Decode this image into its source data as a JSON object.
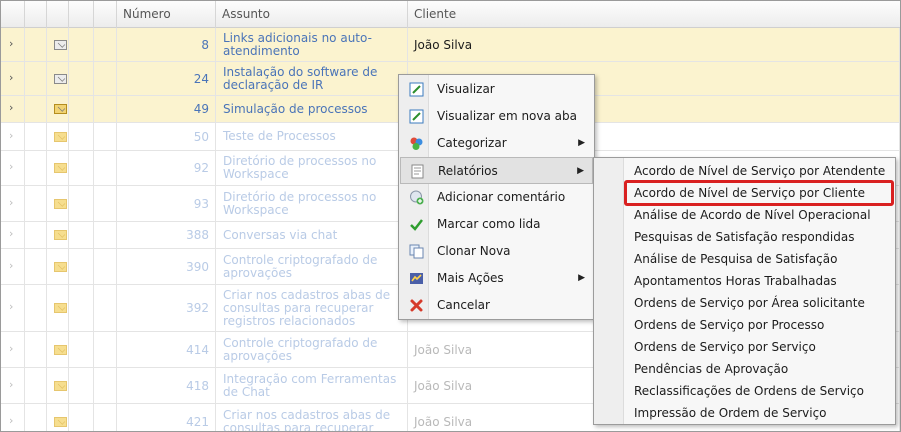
{
  "columns": {
    "numero": "Número",
    "assunto": "Assunto",
    "cliente": "Cliente"
  },
  "rows": [
    {
      "num": "8",
      "subject": "Links adicionais no auto-atendimento",
      "client": "João Silva"
    },
    {
      "num": "24",
      "subject": "Instalação do software de declaração de IR",
      "client": ""
    },
    {
      "num": "49",
      "subject": "Simulação de processos",
      "client": ""
    },
    {
      "num": "50",
      "subject": "Teste de Processos",
      "client": ""
    },
    {
      "num": "92",
      "subject": "Diretório de processos no Workspace",
      "client": ""
    },
    {
      "num": "93",
      "subject": "Diretório de processos no Workspace",
      "client": ""
    },
    {
      "num": "388",
      "subject": "Conversas via chat",
      "client": ""
    },
    {
      "num": "390",
      "subject": "Controle criptografado de aprovações",
      "client": ""
    },
    {
      "num": "392",
      "subject": "Criar nos cadastros abas de consultas para recuperar registros relacionados",
      "client": ""
    },
    {
      "num": "414",
      "subject": "Controle criptografado de aprovações",
      "client": "João Silva"
    },
    {
      "num": "418",
      "subject": "Integração com Ferramentas de Chat",
      "client": "João Silva"
    },
    {
      "num": "421",
      "subject": "Criar nos cadastros abas de consultas para recuperar",
      "client": "João Silva"
    }
  ],
  "context_menu": {
    "items": [
      {
        "label": "Visualizar",
        "icon": "edit-icon"
      },
      {
        "label": "Visualizar em nova aba",
        "icon": "edit-icon"
      },
      {
        "label": "Categorizar",
        "icon": "color-dots-icon"
      },
      {
        "label": "Relatórios",
        "icon": "report-icon"
      },
      {
        "label": "Adicionar comentário",
        "icon": "add-comment-icon"
      },
      {
        "label": "Marcar como lida",
        "icon": "check-icon"
      },
      {
        "label": "Clonar Nova",
        "icon": "clone-icon"
      },
      {
        "label": "Mais Ações",
        "icon": "actions-icon"
      },
      {
        "label": "Cancelar",
        "icon": "cancel-icon"
      }
    ]
  },
  "reports_submenu": {
    "items": [
      "Acordo de Nível de Serviço por Atendente",
      "Acordo de Nível de Serviço por Cliente",
      "Análise de Acordo de Nível Operacional",
      "Pesquisas de Satisfação respondidas",
      "Análise de Pesquisa de Satisfação",
      "Apontamentos Horas Trabalhadas",
      "Ordens de Serviço por Área solicitante",
      "Ordens de Serviço por Processo",
      "Ordens de Serviço por Serviço",
      "Pendências de Aprovação",
      "Reclassificações de Ordens de Serviço",
      "Impressão de Ordem de Serviço"
    ],
    "highlighted_index": 1
  },
  "colors": {
    "highlight_row": "#fbf3cf",
    "link": "#4a74b8",
    "annotation_box": "#d92020"
  }
}
